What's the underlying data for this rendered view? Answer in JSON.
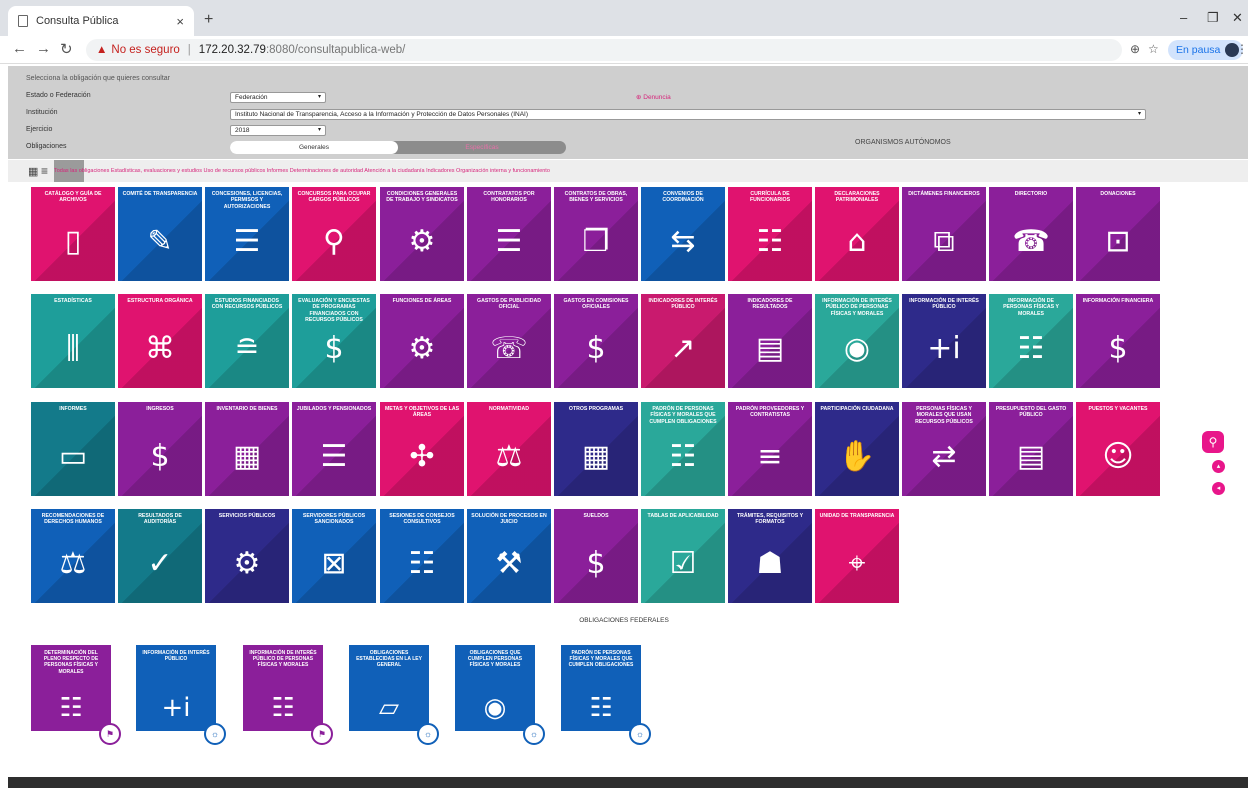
{
  "browser": {
    "tab_title": "Consulta Pública",
    "tab_close": "×",
    "new_tab": "+",
    "warning": "▲",
    "insecure_label": "No es seguro",
    "separator": "|",
    "url_host": "172.20.32.79",
    "url_path": ":8080/consultapublica-web/",
    "pause_label": "En pausa"
  },
  "filters": {
    "instruction": "Selecciona la obligación que quieres consultar",
    "estado_label": "Estado o Federación",
    "estado_value": "Federación",
    "institucion_label": "Institución",
    "institucion_value": "Instituto Nacional de Transparencia, Acceso a la Información y Protección de Datos Personales (INAI)",
    "ejercicio_label": "Ejercicio",
    "ejercicio_value": "2018",
    "obligaciones_label": "Obligaciones",
    "denuncia": "⊕ Denuncia",
    "toggle_on": "Generales",
    "toggle_off": "Específicas",
    "organismos": "ORGANISMOS AUTÓNOMOS"
  },
  "categories": "Todas las obligaciones  Estadísticas, evaluaciones y estudios  Uso de recursos públicos  Informes  Determinaciones de autoridad  Atención a la ciudadanía  Indicadores  Organización interna y funcionamiento",
  "cards": [
    {
      "title": "CATÁLOGO Y GUÍA DE ARCHIVOS",
      "color": "#e0136f",
      "icon": "▯"
    },
    {
      "title": "COMITÉ DE TRANSPARENCIA",
      "color": "#1060b8",
      "icon": "✎"
    },
    {
      "title": "CONCESIONES, LICENCIAS, PERMISOS Y AUTORIZACIONES",
      "color": "#1060b8",
      "icon": "☰"
    },
    {
      "title": "CONCURSOS PARA OCUPAR CARGOS PÚBLICOS",
      "color": "#e0136f",
      "icon": "⚲"
    },
    {
      "title": "CONDICIONES GENERALES DE TRABAJO Y SINDICATOS",
      "color": "#8b1f9a",
      "icon": "⚙"
    },
    {
      "title": "CONTRATATOS POR HONORARIOS",
      "color": "#8b1f9a",
      "icon": "☰"
    },
    {
      "title": "CONTRATOS DE OBRAS, BIENES Y SERVICIOS",
      "color": "#8b1f9a",
      "icon": "❐"
    },
    {
      "title": "CONVENIOS DE COORDINACIÓN",
      "color": "#1060b8",
      "icon": "⇆"
    },
    {
      "title": "CURRÍCULA DE FUNCIONARIOS",
      "color": "#e0136f",
      "icon": "☷"
    },
    {
      "title": "DECLARACIONES PATRIMONIALES",
      "color": "#e0136f",
      "icon": "⌂"
    },
    {
      "title": "DICTÁMENES FINANCIEROS",
      "color": "#8b1f9a",
      "icon": "⧉"
    },
    {
      "title": "DIRECTORIO",
      "color": "#8b1f9a",
      "icon": "☎"
    },
    {
      "title": "DONACIONES",
      "color": "#8b1f9a",
      "icon": "⊡"
    },
    {
      "title": "ESTADÍSTICAS",
      "color": "#1e9e9a",
      "icon": "⫼"
    },
    {
      "title": "ESTRUCTURA ORGÁNICA",
      "color": "#e0136f",
      "icon": "⌘"
    },
    {
      "title": "ESTUDIOS FINANCIADOS CON RECURSOS PÚBLICOS",
      "color": "#1e9e9a",
      "icon": "≘"
    },
    {
      "title": "EVALUACIÓN Y ENCUESTAS DE PROGRAMAS FINANCIADOS CON RECURSOS PÚBLICOS",
      "color": "#1e9e9a",
      "icon": "$"
    },
    {
      "title": "FUNCIONES DE ÁREAS",
      "color": "#8b1f9a",
      "icon": "⚙"
    },
    {
      "title": "GASTOS DE PUBLICIDAD OFICIAL",
      "color": "#8b1f9a",
      "icon": "☏"
    },
    {
      "title": "GASTOS EN COMISIONES OFICIALES",
      "color": "#8b1f9a",
      "icon": "$"
    },
    {
      "title": "INDICADORES DE INTERÉS PÚBLICO",
      "color": "#c91a6e",
      "icon": "↗"
    },
    {
      "title": "INDICADORES DE RESULTADOS",
      "color": "#8b1f9a",
      "icon": "▤"
    },
    {
      "title": "INFORMACIÓN DE INTERÉS PÚBLICO DE PERSONAS FÍSICAS Y MORALES",
      "color": "#2aa89a",
      "icon": "◉"
    },
    {
      "title": "INFORMACIÓN DE INTERÉS PÚBLICO",
      "color": "#2e2a8a",
      "icon": "+i"
    },
    {
      "title": "INFORMACIÓN DE PERSONAS FÍSICAS Y MORALES",
      "color": "#2aa89a",
      "icon": "☷"
    },
    {
      "title": "INFORMACIÓN FINANCIERA",
      "color": "#8b1f9a",
      "icon": "$"
    },
    {
      "title": "INFORMES",
      "color": "#137a8a",
      "icon": "▭"
    },
    {
      "title": "INGRESOS",
      "color": "#8b1f9a",
      "icon": "$"
    },
    {
      "title": "INVENTARIO DE BIENES",
      "color": "#8b1f9a",
      "icon": "▦"
    },
    {
      "title": "JUBILADOS Y PENSIONADOS",
      "color": "#8b1f9a",
      "icon": "☰"
    },
    {
      "title": "METAS Y OBJETIVOS DE LAS ÁREAS",
      "color": "#e0136f",
      "icon": "✣"
    },
    {
      "title": "NORMATIVIDAD",
      "color": "#e0136f",
      "icon": "⚖"
    },
    {
      "title": "OTROS PROGRAMAS",
      "color": "#2e2a8a",
      "icon": "▦"
    },
    {
      "title": "PADRÓN DE PERSONAS FÍSICAS Y MORALES QUE CUMPLEN OBLIGACIONES",
      "color": "#2aa89a",
      "icon": "☷"
    },
    {
      "title": "PADRÓN PROVEEDORES Y CONTRATISTAS",
      "color": "#8b1f9a",
      "icon": "≡"
    },
    {
      "title": "PARTICIPACIÓN CIUDADANA",
      "color": "#2e2a8a",
      "icon": "✋"
    },
    {
      "title": "PERSONAS FÍSICAS Y MORALES QUE USAN RECURSOS PÚBLICOS",
      "color": "#8b1f9a",
      "icon": "⇄"
    },
    {
      "title": "PRESUPUESTO DEL GASTO PÚBLICO",
      "color": "#8b1f9a",
      "icon": "▤"
    },
    {
      "title": "PUESTOS Y VACANTES",
      "color": "#e0136f",
      "icon": "☺"
    },
    {
      "title": "RECOMENDACIONES DE DERECHOS HUMANOS",
      "color": "#1060b8",
      "icon": "⚖"
    },
    {
      "title": "RESULTADOS DE AUDITORÍAS",
      "color": "#137a8a",
      "icon": "✓"
    },
    {
      "title": "SERVICIOS PÚBLICOS",
      "color": "#2e2a8a",
      "icon": "⚙"
    },
    {
      "title": "SERVIDORES PÚBLICOS SANCIONADOS",
      "color": "#1060b8",
      "icon": "⊠"
    },
    {
      "title": "SESIONES DE CONSEJOS CONSULTIVOS",
      "color": "#1060b8",
      "icon": "☷"
    },
    {
      "title": "SOLUCIÓN DE PROCESOS EN JUICIO",
      "color": "#1060b8",
      "icon": "⚒"
    },
    {
      "title": "SUELDOS",
      "color": "#8b1f9a",
      "icon": "$"
    },
    {
      "title": "TABLAS DE APLICABILIDAD",
      "color": "#2aa89a",
      "icon": "☑"
    },
    {
      "title": "TRÁMITES, REQUISITOS Y FORMATOS",
      "color": "#2e2a8a",
      "icon": "☗"
    },
    {
      "title": "UNIDAD DE TRANSPARENCIA",
      "color": "#e0136f",
      "icon": "⌖"
    }
  ],
  "federal_title": "OBLIGACIONES FEDERALES",
  "federal_cards": [
    {
      "title": "DETERMINACIÓN DEL PLENO RESPECTO DE PERSONAS FÍSICAS Y MORALES",
      "color": "#8b1f9a",
      "icon": "☷",
      "badge": "⚑"
    },
    {
      "title": "INFORMACIÓN DE INTERÉS PÚBLICO",
      "color": "#1060b8",
      "icon": "+i",
      "badge": "☼"
    },
    {
      "title": "INFORMACIÓN DE INTERÉS PÚBLICO DE PERSONAS FÍSICAS Y MORALES",
      "color": "#8b1f9a",
      "icon": "☷",
      "badge": "⚑"
    },
    {
      "title": "OBLIGACIONES ESTABLECIDAS EN LA LEY GENERAL",
      "color": "#1060b8",
      "icon": "▱",
      "badge": "☼"
    },
    {
      "title": "OBLIGACIONES QUE CUMPLEN PERSONAS FÍSICAS Y MORALES",
      "color": "#1060b8",
      "icon": "◉",
      "badge": "☼"
    },
    {
      "title": "PADRÓN DE PERSONAS FÍSICAS Y MORALES QUE CUMPLEN OBLIGACIONES",
      "color": "#1060b8",
      "icon": "☷",
      "badge": "☼"
    }
  ]
}
